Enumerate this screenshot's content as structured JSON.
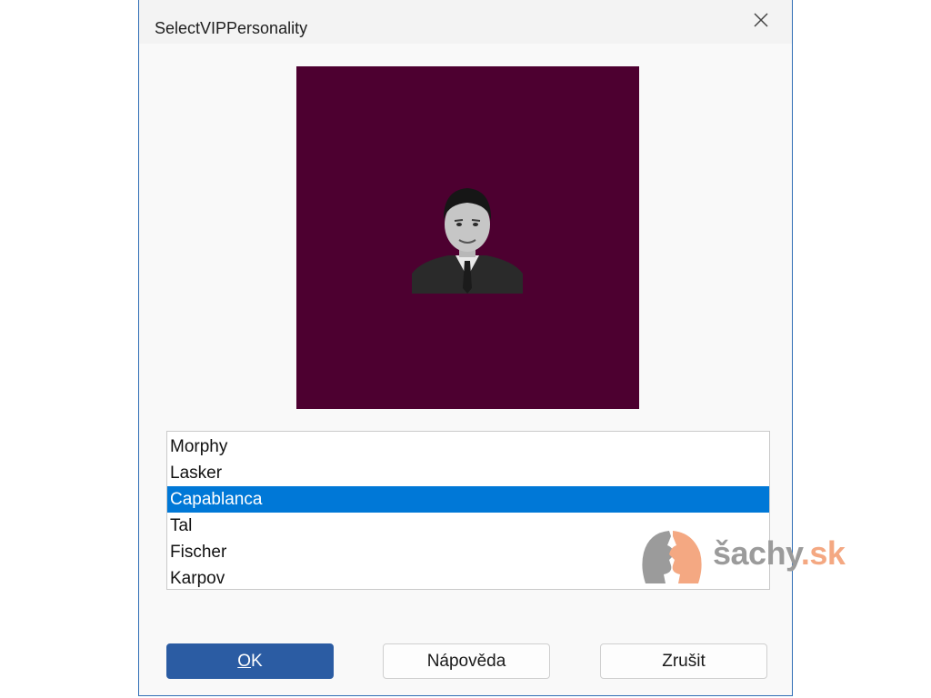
{
  "dialog": {
    "title": "SelectVIPPersonality"
  },
  "personalities": [
    {
      "name": "Morphy",
      "selected": false
    },
    {
      "name": "Lasker",
      "selected": false
    },
    {
      "name": "Capablanca",
      "selected": true
    },
    {
      "name": "Tal",
      "selected": false
    },
    {
      "name": "Fischer",
      "selected": false
    },
    {
      "name": "Karpov",
      "selected": false
    }
  ],
  "buttons": {
    "ok_accel": "O",
    "ok_rest": "K",
    "help": "Nápověda",
    "cancel": "Zrušit"
  },
  "watermark": {
    "main": "šachy",
    "tld": ".sk"
  },
  "colors": {
    "preview_background": "#4d0030",
    "selection": "#0078d7",
    "ok_button": "#2b5ca3",
    "watermark_gray": "#9b9b9b",
    "watermark_peach": "#f4a882"
  },
  "icons": {
    "close": "close-icon",
    "watermark_logo": "chess-knight-faces-logo"
  }
}
